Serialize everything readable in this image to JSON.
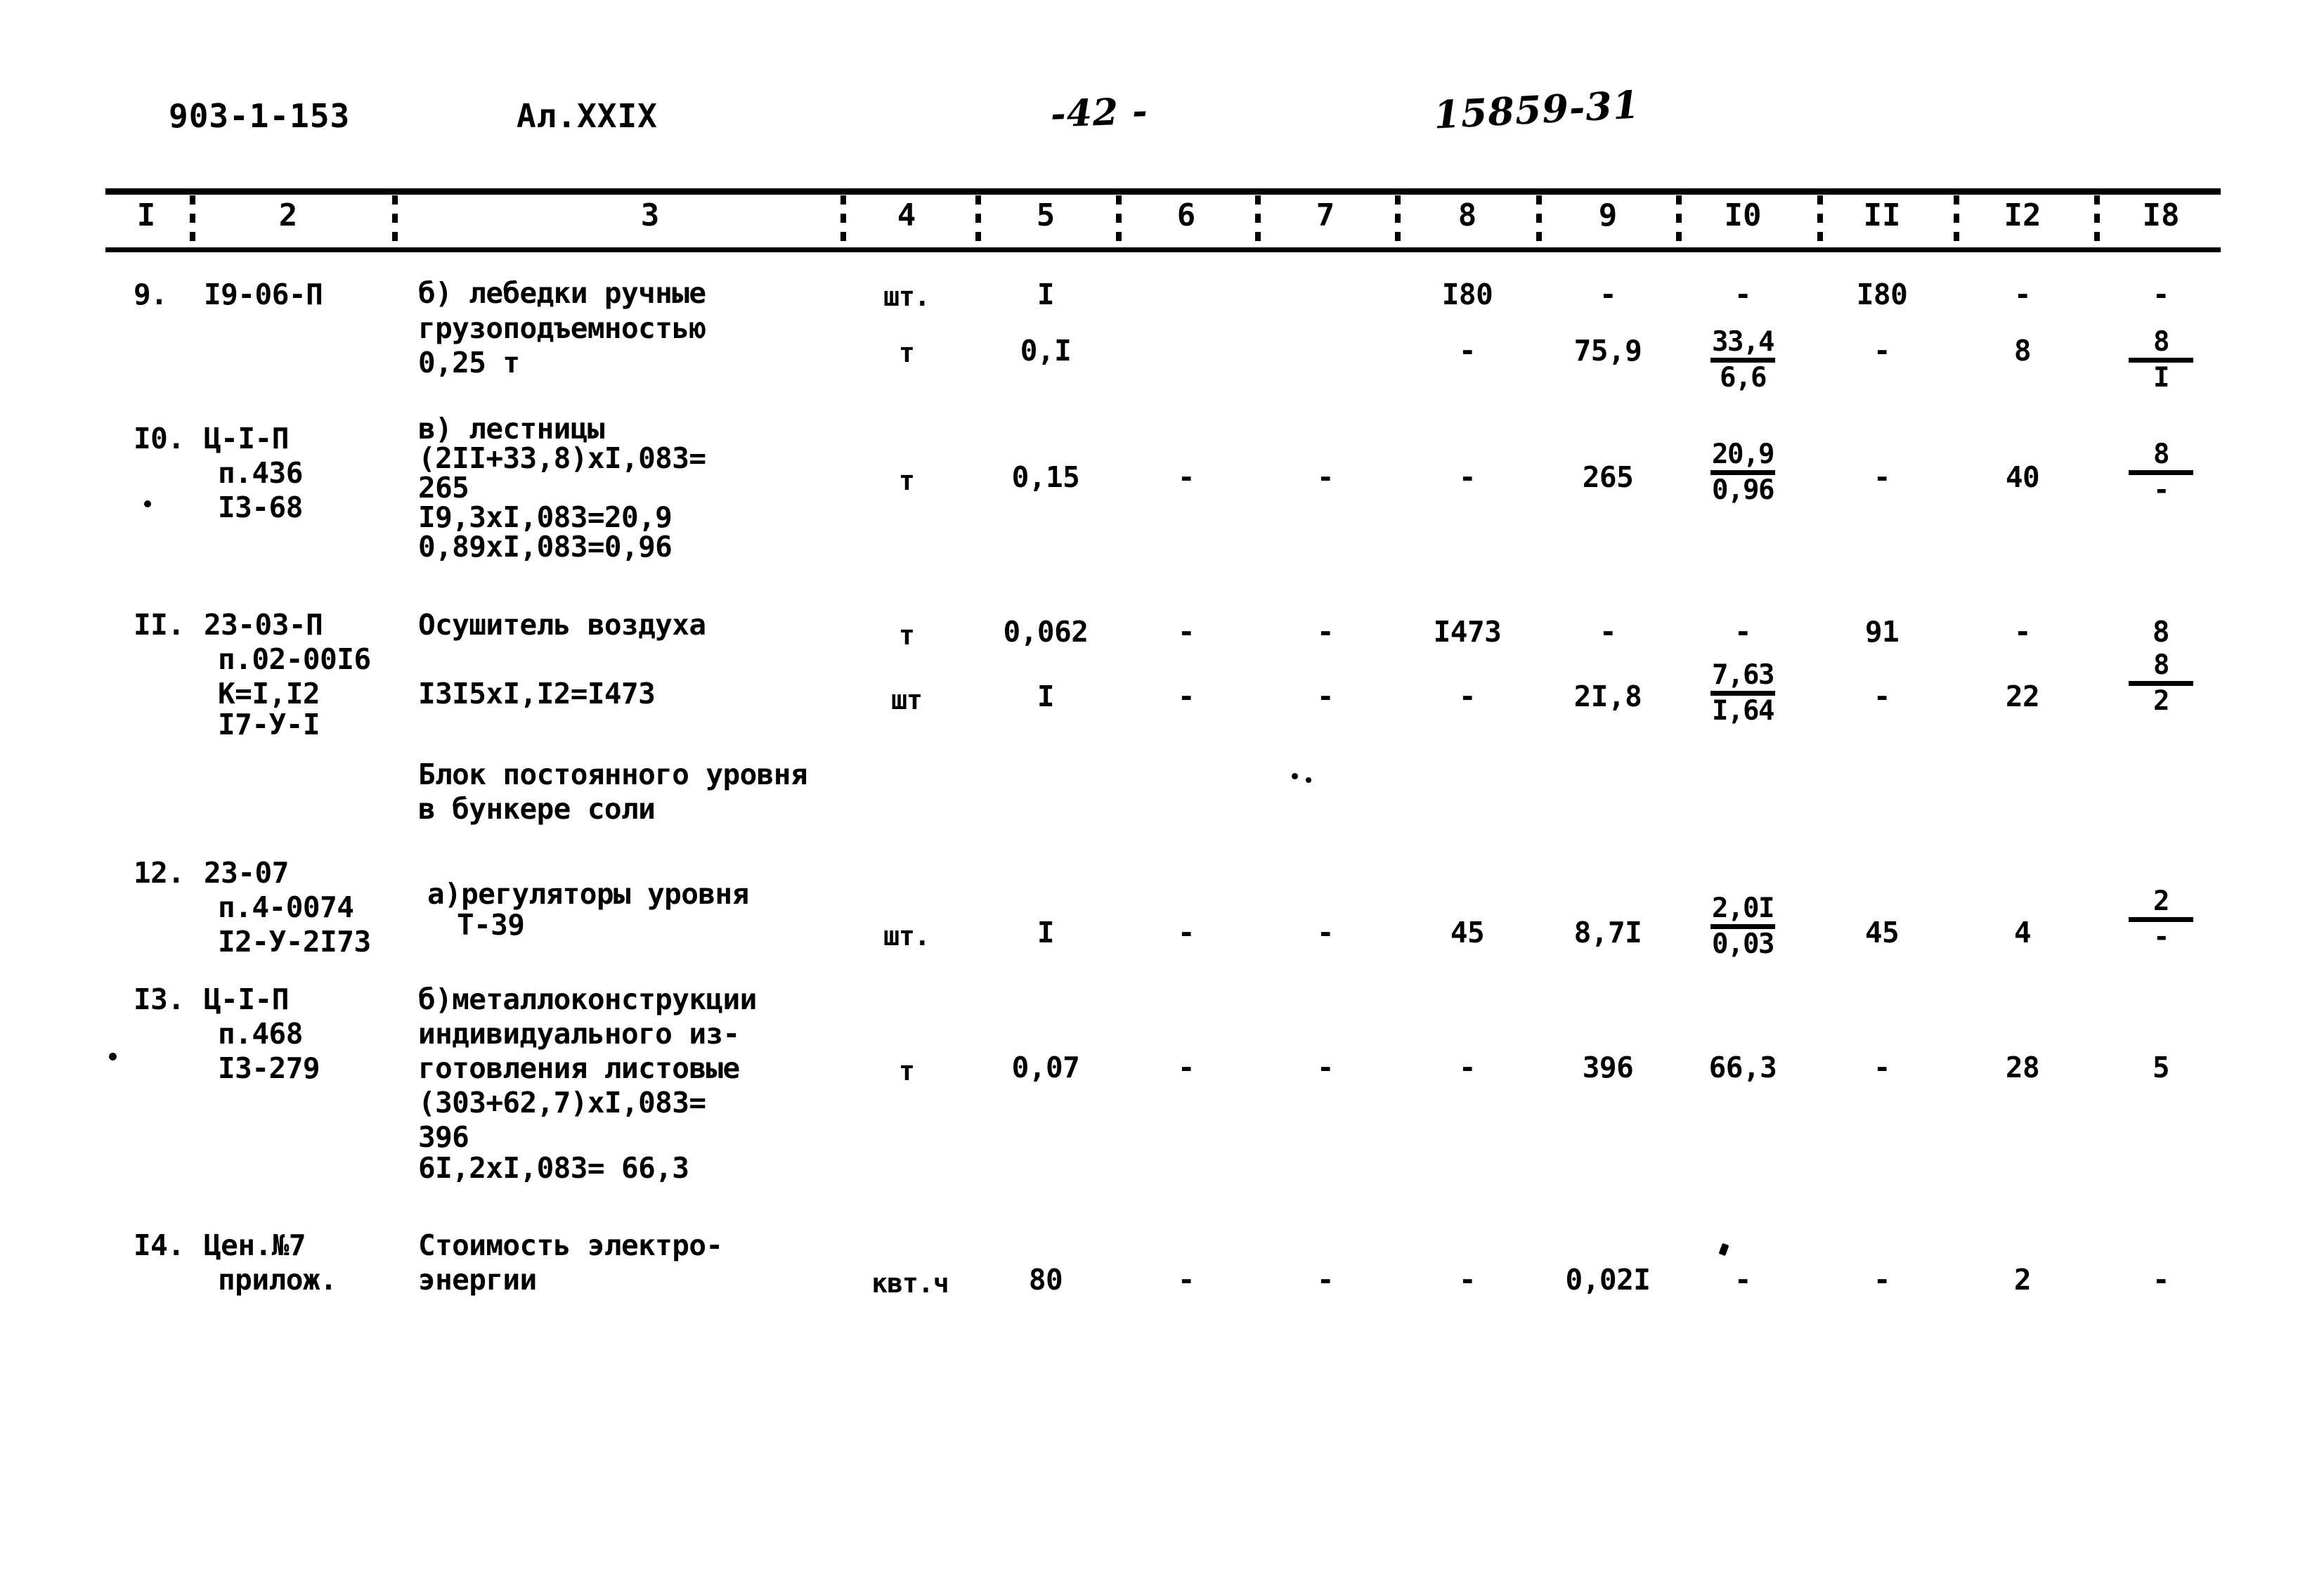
{
  "header": {
    "doc_code": "903-1-153",
    "album": "Ал.XXIX",
    "page_marker": "-42 -",
    "stamp": "15859-31"
  },
  "table": {
    "column_numbers": [
      "I",
      "2",
      "3",
      "4",
      "5",
      "6",
      "7",
      "8",
      "9",
      "I0",
      "II",
      "I2",
      "I8"
    ],
    "rows": [
      {
        "index": "9.",
        "code_lines": [
          "I9-06-П"
        ],
        "description_lines": [
          "б) лебедки ручные",
          "грузоподъемностью",
          "0,25 т"
        ],
        "lines": [
          {
            "unit": "шт.",
            "c5": "I",
            "c6": "",
            "c7": "",
            "c8": "I80",
            "c9": "-",
            "c10_top": "-",
            "c10_bottom": "",
            "c11": "I80",
            "c12": "-",
            "c13_top": "-",
            "c13_bottom": ""
          },
          {
            "unit": "т",
            "c5": "0,I",
            "c6": "",
            "c7": "",
            "c8": "-",
            "c9": "75,9",
            "c10_top": "33,4",
            "c10_bottom": "6,6",
            "c11": "-",
            "c12": "8",
            "c13_top": "8",
            "c13_bottom": "I"
          }
        ]
      },
      {
        "index": "I0.",
        "code_lines": [
          "Ц-I-П",
          "п.436",
          "I3-68"
        ],
        "description_lines": [
          "в) лестницы",
          "(2II+33,8)хI,083=",
          "265",
          "I9,3хI,083=20,9",
          "0,89хI,083=0,96"
        ],
        "lines": [
          {
            "unit": "т",
            "c5": "0,15",
            "c6": "-",
            "c7": "-",
            "c8": "-",
            "c9": "265",
            "c10_top": "20,9",
            "c10_bottom": "0,96",
            "c11": "-",
            "c12": "40",
            "c13_top": "8",
            "c13_bottom": "-"
          }
        ]
      },
      {
        "index": "II.",
        "code_lines": [
          "23-03-П",
          "п.02-00I6",
          "К=I,I2",
          "I7-У-I"
        ],
        "description_lines": [
          "Осушитель воздуха",
          "",
          "I3I5хI,I2=I473"
        ],
        "lines": [
          {
            "unit": "т",
            "c5": "0,062",
            "c6": "-",
            "c7": "-",
            "c8": "I473",
            "c9": "-",
            "c10_top": "-",
            "c10_bottom": "",
            "c11": "91",
            "c12": "-",
            "c13_top": "8",
            "c13_bottom": ""
          },
          {
            "unit": "шт",
            "c5": "I",
            "c6": "-",
            "c7": "-",
            "c8": "-",
            "c9": "2I,8",
            "c10_top": "7,63",
            "c10_bottom": "I,64",
            "c11": "-",
            "c12": "22",
            "c13_top": "",
            "c13_bottom": "2"
          }
        ]
      },
      {
        "index": "",
        "code_lines": [],
        "description_lines": [
          "Блок постоянного уровня",
          "в бункере соли"
        ],
        "lines": []
      },
      {
        "index": "12.",
        "code_lines": [
          "23-07",
          "п.4-0074",
          "I2-У-2I73"
        ],
        "description_lines": [
          "а)регуляторы уровня",
          "Т-39"
        ],
        "lines": [
          {
            "unit": "шт.",
            "c5": "I",
            "c6": "-",
            "c7": "-",
            "c8": "45",
            "c9": "8,7I",
            "c10_top": "2,0I",
            "c10_bottom": "0,03",
            "c11": "45",
            "c12": "4",
            "c13_top": "2",
            "c13_bottom": "-"
          }
        ]
      },
      {
        "index": "I3.",
        "code_lines": [
          "Ц-I-П",
          "п.468",
          "I3-279"
        ],
        "description_lines": [
          "б)металлоконструкции",
          "индивидуального из-",
          "готовления листовые",
          "(303+62,7)хI,083=",
          "396",
          "6I,2хI,083= 66,3"
        ],
        "lines": [
          {
            "unit": "т",
            "c5": "0,07",
            "c6": "-",
            "c7": "-",
            "c8": "-",
            "c9": "396",
            "c10_top": "66,3",
            "c10_bottom": "",
            "c11": "-",
            "c12": "28",
            "c13_top": "5",
            "c13_bottom": ""
          }
        ]
      },
      {
        "index": "I4.",
        "code_lines": [
          "Цен.№7",
          "прилож."
        ],
        "description_lines": [
          "Стоимость электро-",
          "энергии"
        ],
        "lines": [
          {
            "unit": "квт.ч",
            "c5": "80",
            "c6": "-",
            "c7": "-",
            "c8": "-",
            "c9": "0,02I",
            "c10_top": "-",
            "c10_bottom": "",
            "c11": "-",
            "c12": "2",
            "c13_top": "-",
            "c13_bottom": ""
          }
        ]
      }
    ]
  }
}
